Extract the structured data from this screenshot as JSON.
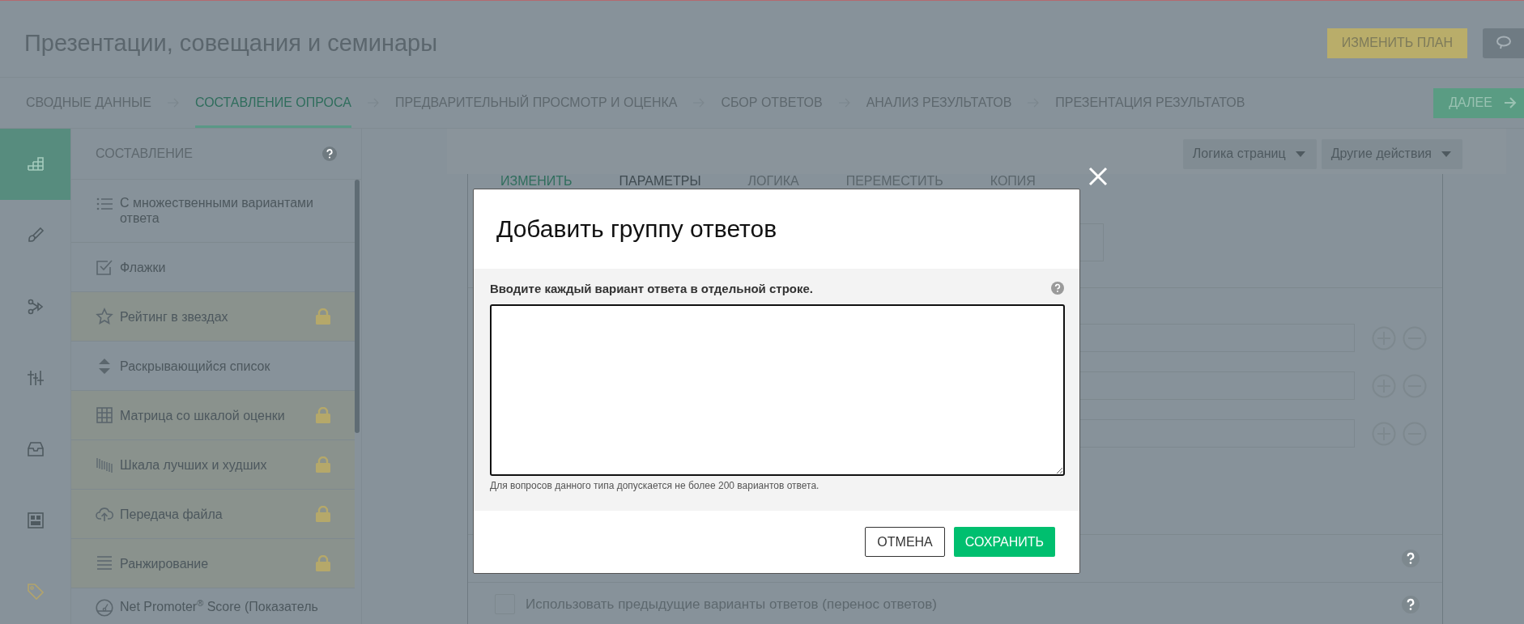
{
  "header": {
    "title": "Презентации, совещания и семинары",
    "upgrade_button": "ИЗМЕНИТЬ ПЛАН"
  },
  "steps": [
    {
      "label": "СВОДНЫЕ ДАННЫЕ",
      "selected": false
    },
    {
      "label": "СОСТАВЛЕНИЕ ОПРОСА",
      "selected": true
    },
    {
      "label": "ПРЕДВАРИТЕЛЬНЫЙ ПРОСМОТР И ОЦЕНКА",
      "selected": false
    },
    {
      "label": "СБОР ОТВЕТОВ",
      "selected": false
    },
    {
      "label": "АНАЛИЗ РЕЗУЛЬТАТОВ",
      "selected": false
    },
    {
      "label": "ПРЕЗЕНТАЦИЯ РЕЗУЛЬТАТОВ",
      "selected": false
    }
  ],
  "next_button": "ДАЛЕЕ",
  "rail": [
    {
      "selected": true
    },
    {
      "selected": false
    },
    {
      "selected": false
    },
    {
      "selected": false
    },
    {
      "selected": false
    },
    {
      "selected": false
    },
    {
      "selected": false
    }
  ],
  "builder": {
    "title": "СОСТАВЛЕНИЕ",
    "items": [
      {
        "label": "С множественными вариантами ответа",
        "locked": false
      },
      {
        "label": "Флажки",
        "locked": false
      },
      {
        "label": "Рейтинг в звездах",
        "locked": true
      },
      {
        "label": "Раскрывающийся список",
        "locked": false
      },
      {
        "label": "Матрица со шкалой оценки",
        "locked": true
      },
      {
        "label": "Шкала лучших и худших",
        "locked": true
      },
      {
        "label": "Передача файла",
        "locked": true
      },
      {
        "label": "Ранжирование",
        "locked": true
      },
      {
        "label": "Net Promoter$^{®}$ Score (Показатель",
        "locked": false
      }
    ]
  },
  "toolbar": [
    "Логика страниц",
    "Другие действия"
  ],
  "question_tabs": [
    {
      "label": "ИЗМЕНИТЬ",
      "selected": true,
      "disabled": false
    },
    {
      "label": "ПАРАМЕТРЫ",
      "selected": false,
      "disabled": false
    },
    {
      "label": "ЛОГИКА",
      "selected": false,
      "disabled": true
    },
    {
      "label": "ПЕРЕМЕСТИТЬ",
      "selected": false,
      "disabled": true
    },
    {
      "label": "КОПИЯ",
      "selected": false,
      "disabled": true
    }
  ],
  "options": [
    {
      "label": "Использовать предыдущие варианты ответов (перенос ответов)",
      "checked": false
    }
  ],
  "dialog": {
    "title": "Добавить группу ответов",
    "label": "Вводите каждый вариант ответа в отдельной строке.",
    "hint": "Для вопросов данного типа допускается не более 200 вариантов ответа.",
    "buttons": [
      {
        "label": "ОТМЕНА",
        "kind": "secondary"
      },
      {
        "label": "СОХРАНИТЬ",
        "kind": "primary"
      }
    ]
  }
}
